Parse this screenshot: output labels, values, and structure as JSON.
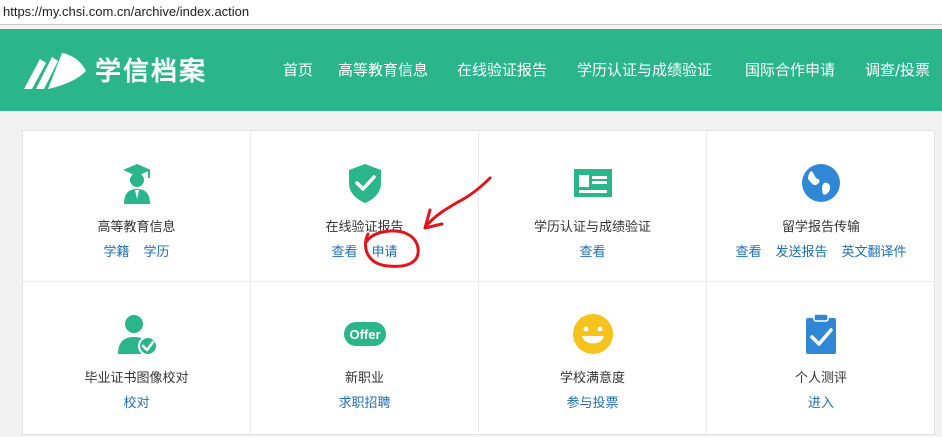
{
  "browser": {
    "url": "https://my.chsi.com.cn/archive/index.action"
  },
  "header": {
    "brand": "学信档案",
    "nav": [
      "首页",
      "高等教育信息",
      "在线验证报告",
      "学历认证与成绩验证",
      "国际合作申请",
      "调查/投票"
    ]
  },
  "cards": [
    {
      "title": "高等教育信息",
      "icon": "graduate-icon",
      "links": [
        "学籍",
        "学历"
      ]
    },
    {
      "title": "在线验证报告",
      "icon": "shield-check-icon",
      "links": [
        "查看",
        "申请"
      ]
    },
    {
      "title": "学历认证与成绩验证",
      "icon": "certificate-icon",
      "links": [
        "查看"
      ]
    },
    {
      "title": "留学报告传输",
      "icon": "globe-icon",
      "links": [
        "查看",
        "发送报告",
        "英文翻译件"
      ]
    },
    {
      "title": "毕业证书图像校对",
      "icon": "user-check-icon",
      "links": [
        "校对"
      ]
    },
    {
      "title": "新职业",
      "icon": "offer-icon",
      "icon_text": "Offer",
      "links": [
        "求职招聘"
      ]
    },
    {
      "title": "学校满意度",
      "icon": "smiley-icon",
      "links": [
        "参与投票"
      ]
    },
    {
      "title": "个人测评",
      "icon": "clipboard-check-icon",
      "links": [
        "进入"
      ]
    }
  ],
  "colors": {
    "header_bg": "#2ab68a",
    "icon_green": "#2ab68a",
    "icon_blue": "#2f87d6",
    "icon_yellow": "#f7c21b",
    "link": "#1d6fb8",
    "annotation": "#e0141b"
  }
}
